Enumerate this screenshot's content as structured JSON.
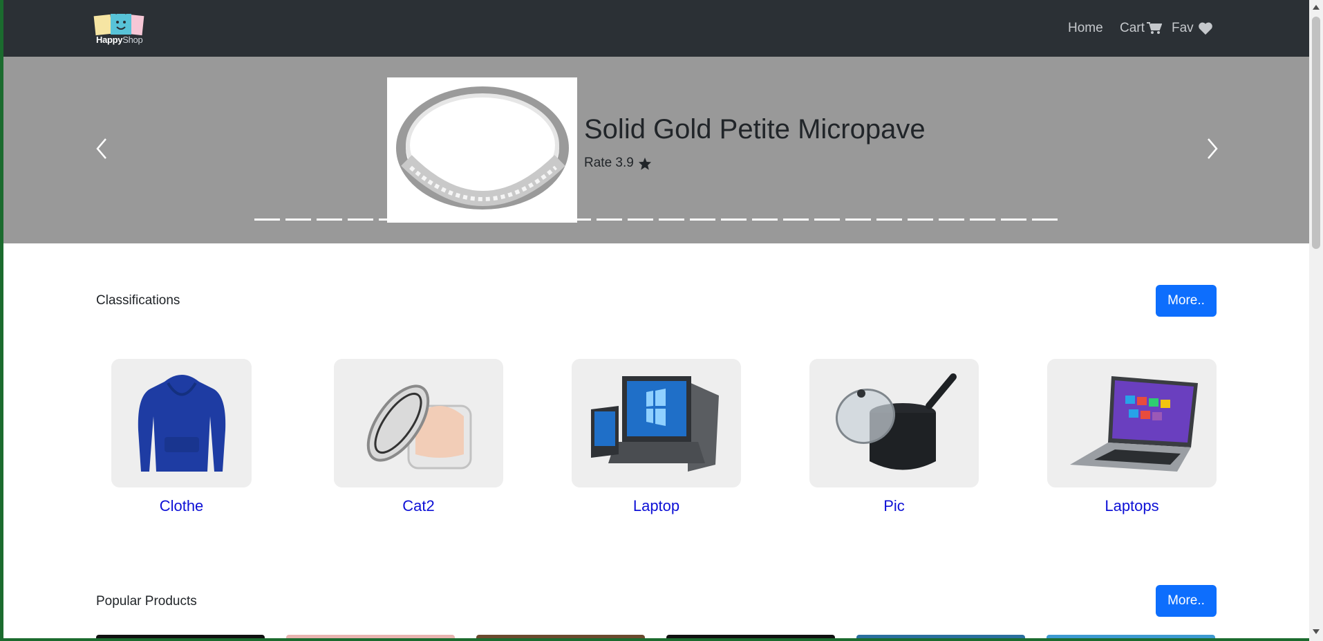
{
  "brand": {
    "name_part1": "Happy",
    "name_part2": "Shop"
  },
  "nav": {
    "home": "Home",
    "cart": "Cart",
    "fav": "Fav"
  },
  "hero": {
    "title": "Solid Gold Petite Micropave",
    "rate_label": "Rate 3.9",
    "slide_count": 26,
    "active_slide": 7
  },
  "classifications": {
    "title": "Classifications",
    "more_label": "More..",
    "items": [
      {
        "label": "Clothe",
        "icon": "hoodie-icon"
      },
      {
        "label": "Cat2",
        "icon": "cream-jar-icon"
      },
      {
        "label": "Laptop",
        "icon": "laptop-icon"
      },
      {
        "label": "Pic",
        "icon": "cooking-pot-icon"
      },
      {
        "label": "Laptops",
        "icon": "laptop-icon"
      }
    ]
  },
  "popular": {
    "title": "Popular Products",
    "more_label": "More..",
    "strip_colors": [
      "#111111",
      "#e8b4b0",
      "#6b4a2e",
      "#111111",
      "#2a6f9e",
      "#3d9ad1"
    ]
  },
  "colors": {
    "navbar": "#2b3035",
    "hero": "#999999",
    "primary": "#0d6efd",
    "link": "#0d10d6"
  }
}
